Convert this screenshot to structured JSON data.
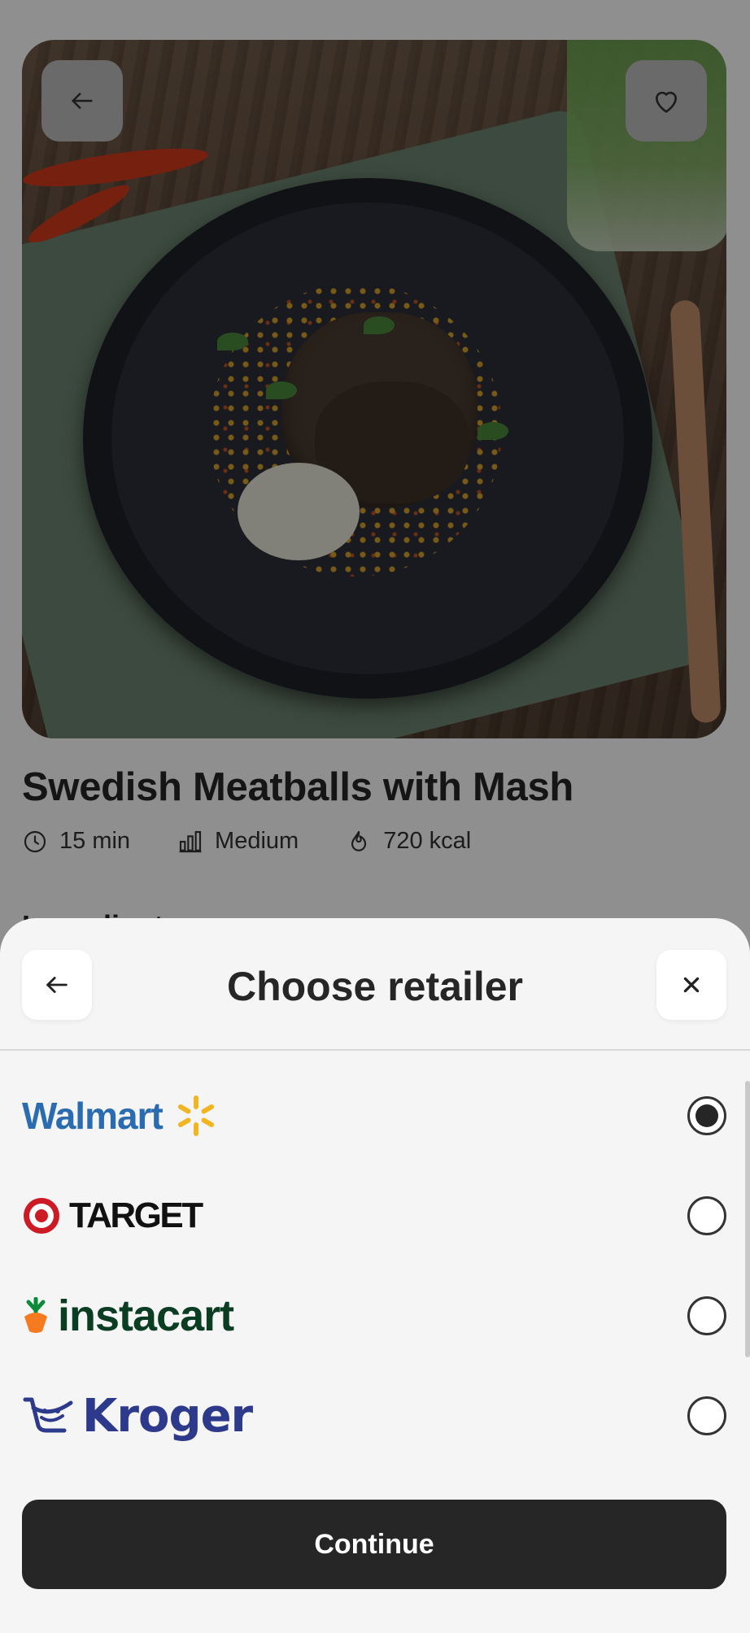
{
  "recipe": {
    "title": "Swedish Meatballs with Mash",
    "time": "15 min",
    "difficulty": "Medium",
    "calories": "720 kcal",
    "section_heading_peek": "Ingredients"
  },
  "icons": {
    "back": "arrow-left-icon",
    "favorite": "heart-icon",
    "time": "clock-icon",
    "difficulty": "bar-chart-icon",
    "calories": "flame-icon",
    "close": "close-icon"
  },
  "sheet": {
    "title": "Choose retailer",
    "retailers": [
      {
        "name": "Walmart",
        "selected": true,
        "color": "#2b6cb0",
        "accent": "#f2b522"
      },
      {
        "name": "TARGET",
        "selected": false,
        "color": "#111111",
        "accent": "#cc1b24"
      },
      {
        "name": "instacart",
        "selected": false,
        "color": "#0b3d23",
        "accent": "#f57a20"
      },
      {
        "name": "Kroger",
        "selected": false,
        "color": "#2d3a8c"
      }
    ],
    "continue_label": "Continue"
  }
}
